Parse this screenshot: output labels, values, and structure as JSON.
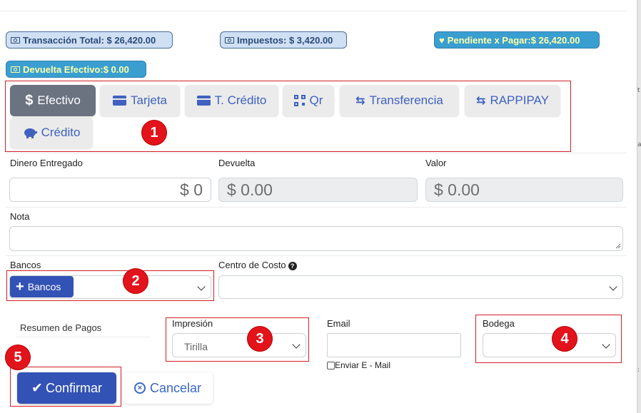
{
  "summary": {
    "total": "Transacción Total: $ 26,420.00",
    "taxes": "Impuestos: $ 3,420.00",
    "pending": "Pendiente x Pagar:$ 26,420.00",
    "change": "Devuelta Efectivo:$ 0.00"
  },
  "payment_methods": [
    {
      "label": "Efectivo",
      "icon": "dollar-icon"
    },
    {
      "label": "Tarjeta",
      "icon": "credit-card-icon"
    },
    {
      "label": "T. Crédito",
      "icon": "credit-card-icon"
    },
    {
      "label": "Qr",
      "icon": "qr-code-icon"
    },
    {
      "label": "Transferencia",
      "icon": "exchange-icon"
    },
    {
      "label": "RAPPIPAY",
      "icon": "exchange-icon"
    },
    {
      "label": "Crédito",
      "icon": "piggy-bank-icon"
    }
  ],
  "fields": {
    "dinero_label": "Dinero Entregado",
    "dinero_value": "$ 0",
    "devuelta_label": "Devuelta",
    "devuelta_value": "$ 0.00",
    "valor_label": "Valor",
    "valor_value": "$ 0.00",
    "nota_label": "Nota",
    "bancos_label": "Bancos",
    "bancos_button": "Bancos",
    "centro_label": "Centro de Costo",
    "resumen_label": "Resumen de Pagos",
    "impresion_label": "Impresión",
    "impresion_value": "Tirilla",
    "email_label": "Email",
    "enviar_label": "Enviar E - Mail",
    "bodega_label": "Bodega"
  },
  "actions": {
    "confirm": "Confirmar",
    "cancel": "Cancelar"
  },
  "annotations": [
    "1",
    "2",
    "3",
    "4",
    "5"
  ],
  "edge_marks": [
    "t",
    "a",
    ":"
  ],
  "colors": {
    "primary": "#3352b5",
    "annotation_red": "#e3131b",
    "badge_light": "#cfe0f5",
    "badge_green": "#3a9fd0"
  }
}
